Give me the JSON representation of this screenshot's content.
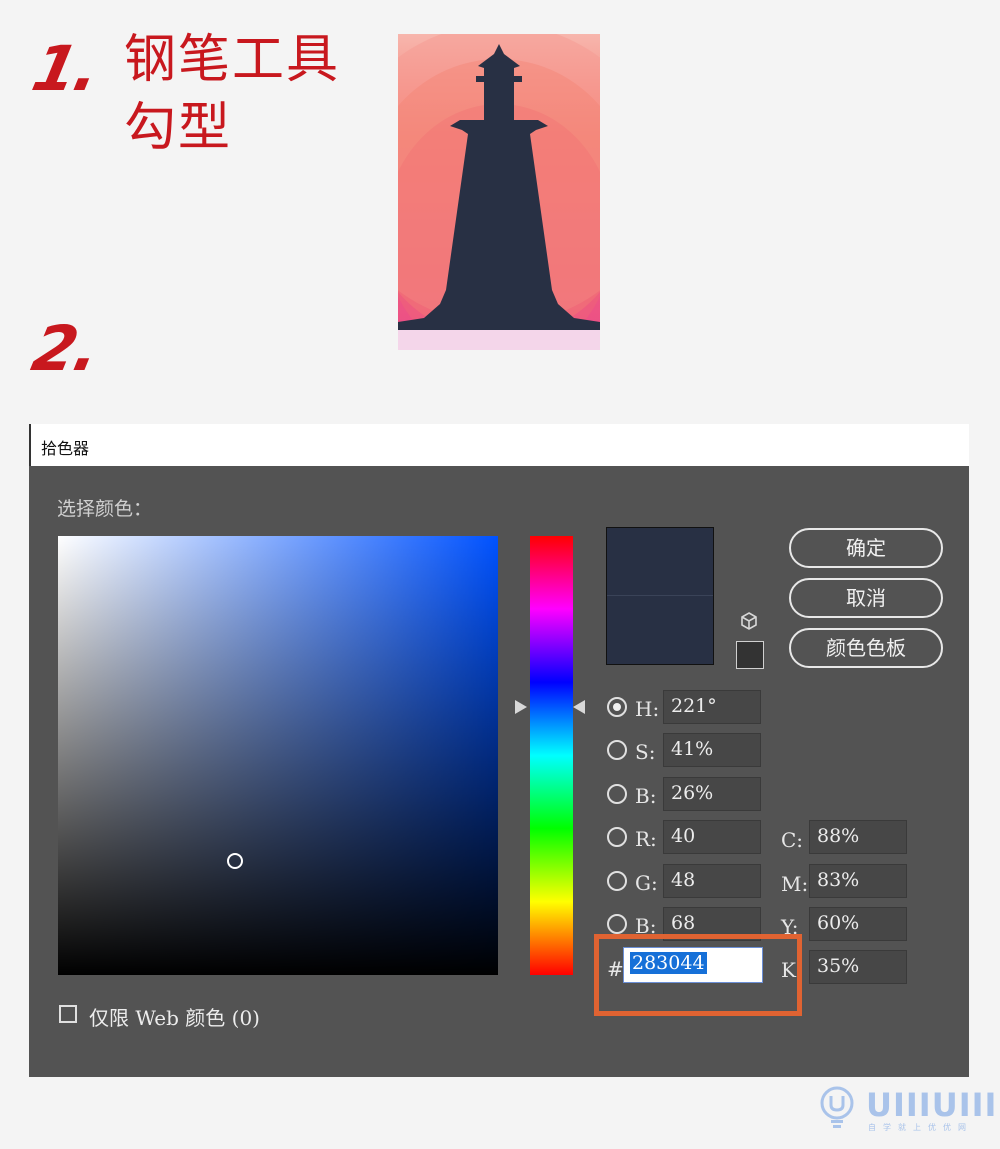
{
  "step1": {
    "number": "1.",
    "line1": "钢笔工具",
    "line2": "勾型"
  },
  "step2": {
    "number": "2."
  },
  "dialog": {
    "title": "拾色器",
    "select_label": "选择颜色：",
    "buttons": {
      "ok": "确定",
      "cancel": "取消",
      "swatches": "颜色色板"
    },
    "fields": {
      "H": {
        "label": "H:",
        "value": "221°"
      },
      "S": {
        "label": "S:",
        "value": "41%"
      },
      "B": {
        "label": "B:",
        "value": "26%"
      },
      "R": {
        "label": "R:",
        "value": "40"
      },
      "G": {
        "label": "G:",
        "value": "48"
      },
      "Bl": {
        "label": "B:",
        "value": "68"
      },
      "C": {
        "label": "C:",
        "value": "88%"
      },
      "M": {
        "label": "M:",
        "value": "83%"
      },
      "Y": {
        "label": "Y:",
        "value": "60%"
      },
      "K": {
        "label": "K",
        "value": "35%"
      }
    },
    "hex": {
      "label": "#",
      "value": "283044"
    },
    "web_only": "仅限 Web 颜色 (0)",
    "selected_color": "#283044",
    "highlight_color": "#e06332"
  },
  "watermark": {
    "brand": "UIIIUIII",
    "tagline": "自学就上优优网"
  },
  "colors": {
    "accent_red": "#c8181e",
    "lighthouse_dark": "#283044"
  }
}
